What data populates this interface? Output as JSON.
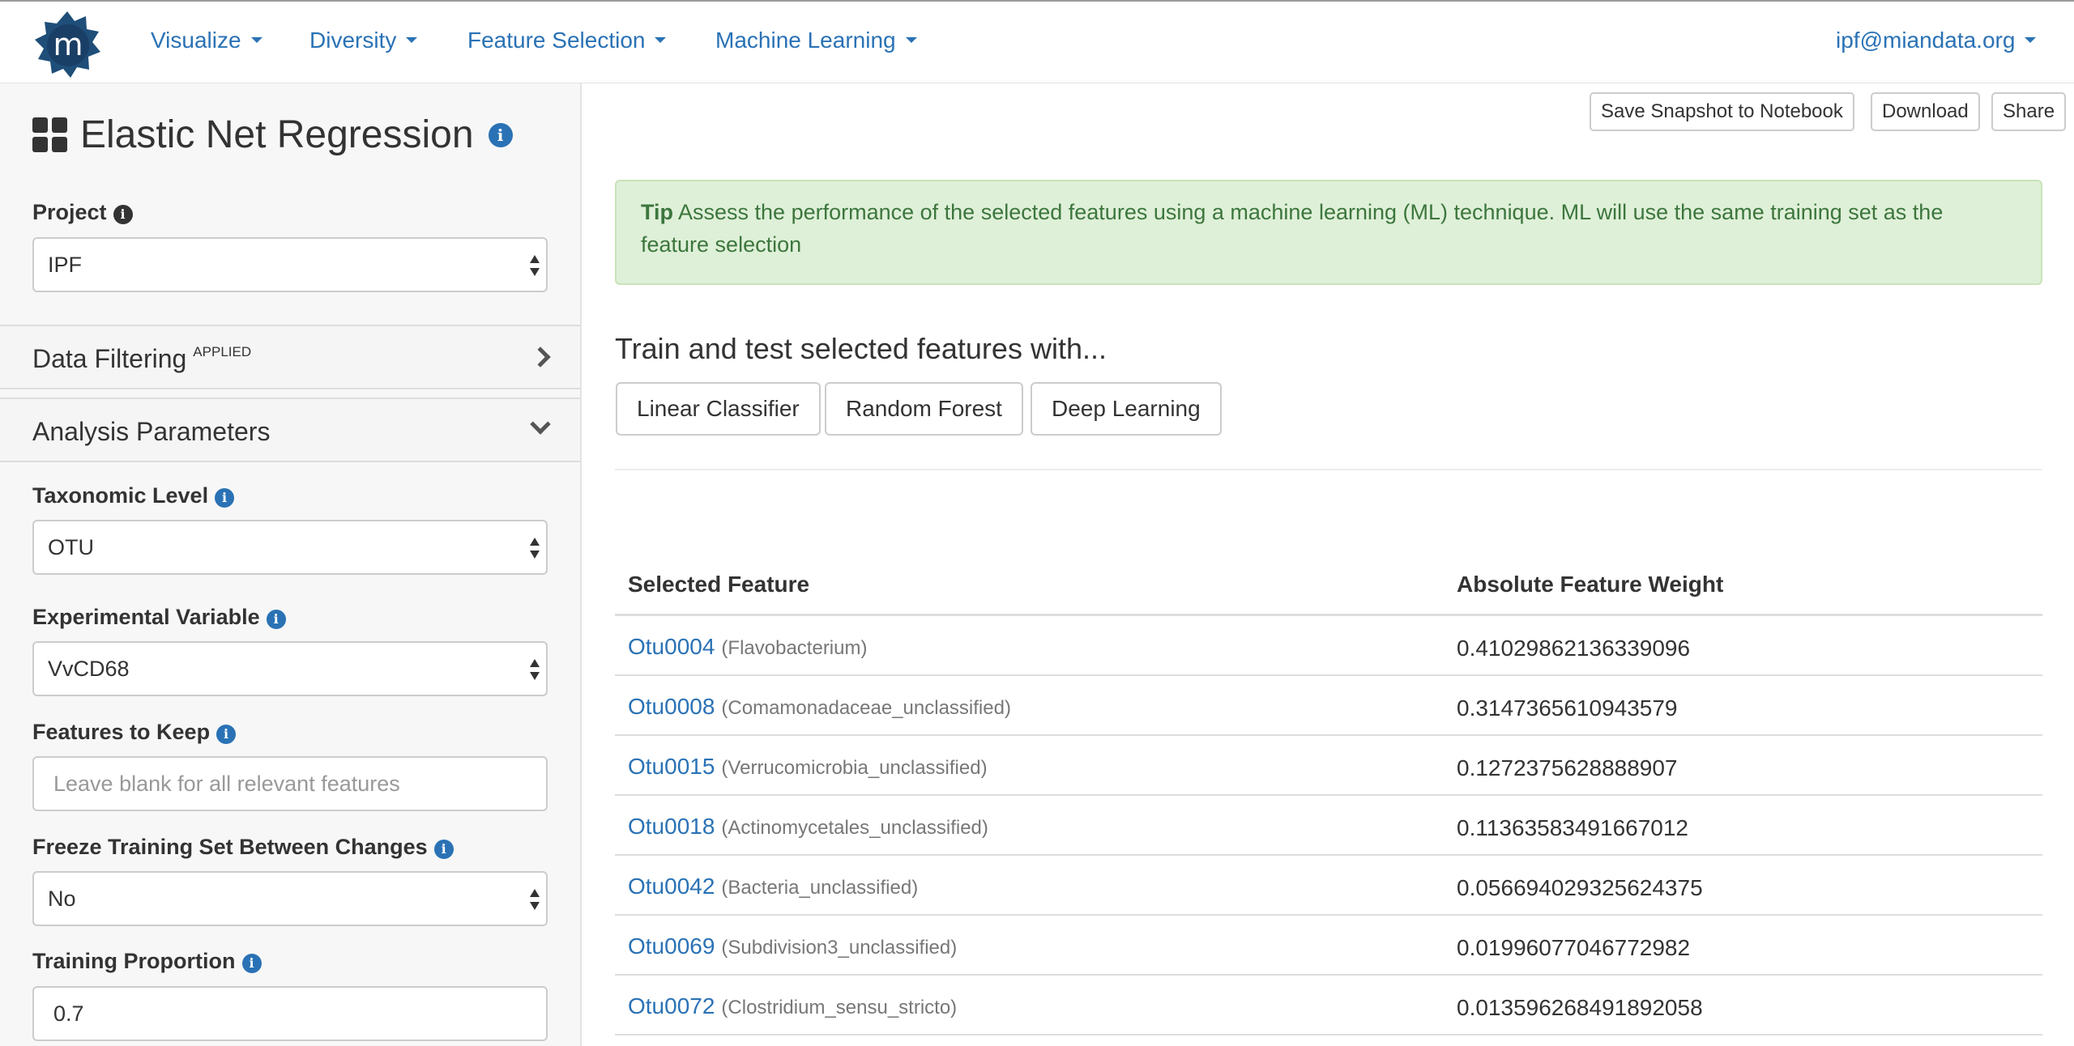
{
  "nav": {
    "items": [
      {
        "label": "Visualize"
      },
      {
        "label": "Diversity"
      },
      {
        "label": "Feature Selection"
      },
      {
        "label": "Machine Learning"
      }
    ],
    "user": "ipf@miandata.org",
    "logo_letter": "m"
  },
  "sidebar": {
    "title": "Elastic Net Regression",
    "project_label": "Project",
    "project_value": "IPF",
    "data_filtering": {
      "title": "Data Filtering",
      "badge": "APPLIED"
    },
    "analysis_parameters": {
      "title": "Analysis Parameters"
    },
    "taxonomic_level": {
      "label": "Taxonomic Level",
      "value": "OTU"
    },
    "experimental_variable": {
      "label": "Experimental Variable",
      "value": "VvCD68"
    },
    "features_to_keep": {
      "label": "Features to Keep",
      "placeholder": "Leave blank for all relevant features"
    },
    "freeze_training": {
      "label": "Freeze Training Set Between Changes",
      "value": "No"
    },
    "training_proportion": {
      "label": "Training Proportion",
      "value": "0.7"
    }
  },
  "actions": {
    "save_snapshot": "Save Snapshot to Notebook",
    "download": "Download",
    "share": "Share"
  },
  "tip": {
    "label": "Tip",
    "text": "Assess the performance of the selected features using a machine learning (ML) technique. ML will use the same training set as the feature selection"
  },
  "train": {
    "heading": "Train and test selected features with...",
    "buttons": [
      "Linear Classifier",
      "Random Forest",
      "Deep Learning"
    ]
  },
  "table": {
    "headers": [
      "Selected Feature",
      "Absolute Feature Weight"
    ],
    "rows": [
      {
        "id": "Otu0004",
        "taxon": "(Flavobacterium)",
        "weight": "0.41029862136339096"
      },
      {
        "id": "Otu0008",
        "taxon": "(Comamonadaceae_unclassified)",
        "weight": "0.3147365610943579"
      },
      {
        "id": "Otu0015",
        "taxon": "(Verrucomicrobia_unclassified)",
        "weight": "0.1272375628888907"
      },
      {
        "id": "Otu0018",
        "taxon": "(Actinomycetales_unclassified)",
        "weight": "0.11363583491667012"
      },
      {
        "id": "Otu0042",
        "taxon": "(Bacteria_unclassified)",
        "weight": "0.056694029325624375"
      },
      {
        "id": "Otu0069",
        "taxon": "(Subdivision3_unclassified)",
        "weight": "0.01996077046772982"
      },
      {
        "id": "Otu0072",
        "taxon": "(Clostridium_sensu_stricto)",
        "weight": "0.013596268491892058"
      }
    ]
  }
}
